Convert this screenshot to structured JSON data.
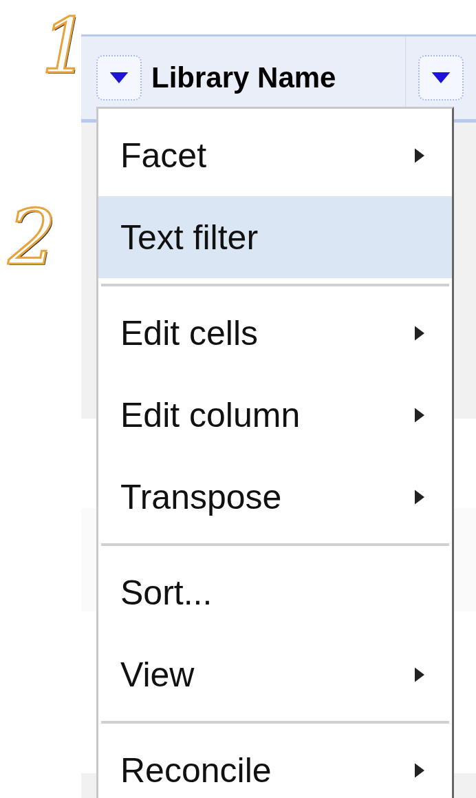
{
  "annotations": [
    "1",
    "2"
  ],
  "columns": [
    {
      "label": "Library Name"
    },
    {}
  ],
  "menu": [
    {
      "kind": "item",
      "label": "Facet",
      "submenu": true,
      "selected": false
    },
    {
      "kind": "item",
      "label": "Text filter",
      "submenu": false,
      "selected": true
    },
    {
      "kind": "separator"
    },
    {
      "kind": "item",
      "label": "Edit cells",
      "submenu": true,
      "selected": false
    },
    {
      "kind": "item",
      "label": "Edit column",
      "submenu": true,
      "selected": false
    },
    {
      "kind": "item",
      "label": "Transpose",
      "submenu": true,
      "selected": false
    },
    {
      "kind": "separator"
    },
    {
      "kind": "item",
      "label": "Sort...",
      "submenu": false,
      "selected": false
    },
    {
      "kind": "item",
      "label": "View",
      "submenu": true,
      "selected": false
    },
    {
      "kind": "separator"
    },
    {
      "kind": "item",
      "label": "Reconcile",
      "submenu": true,
      "selected": false
    }
  ]
}
